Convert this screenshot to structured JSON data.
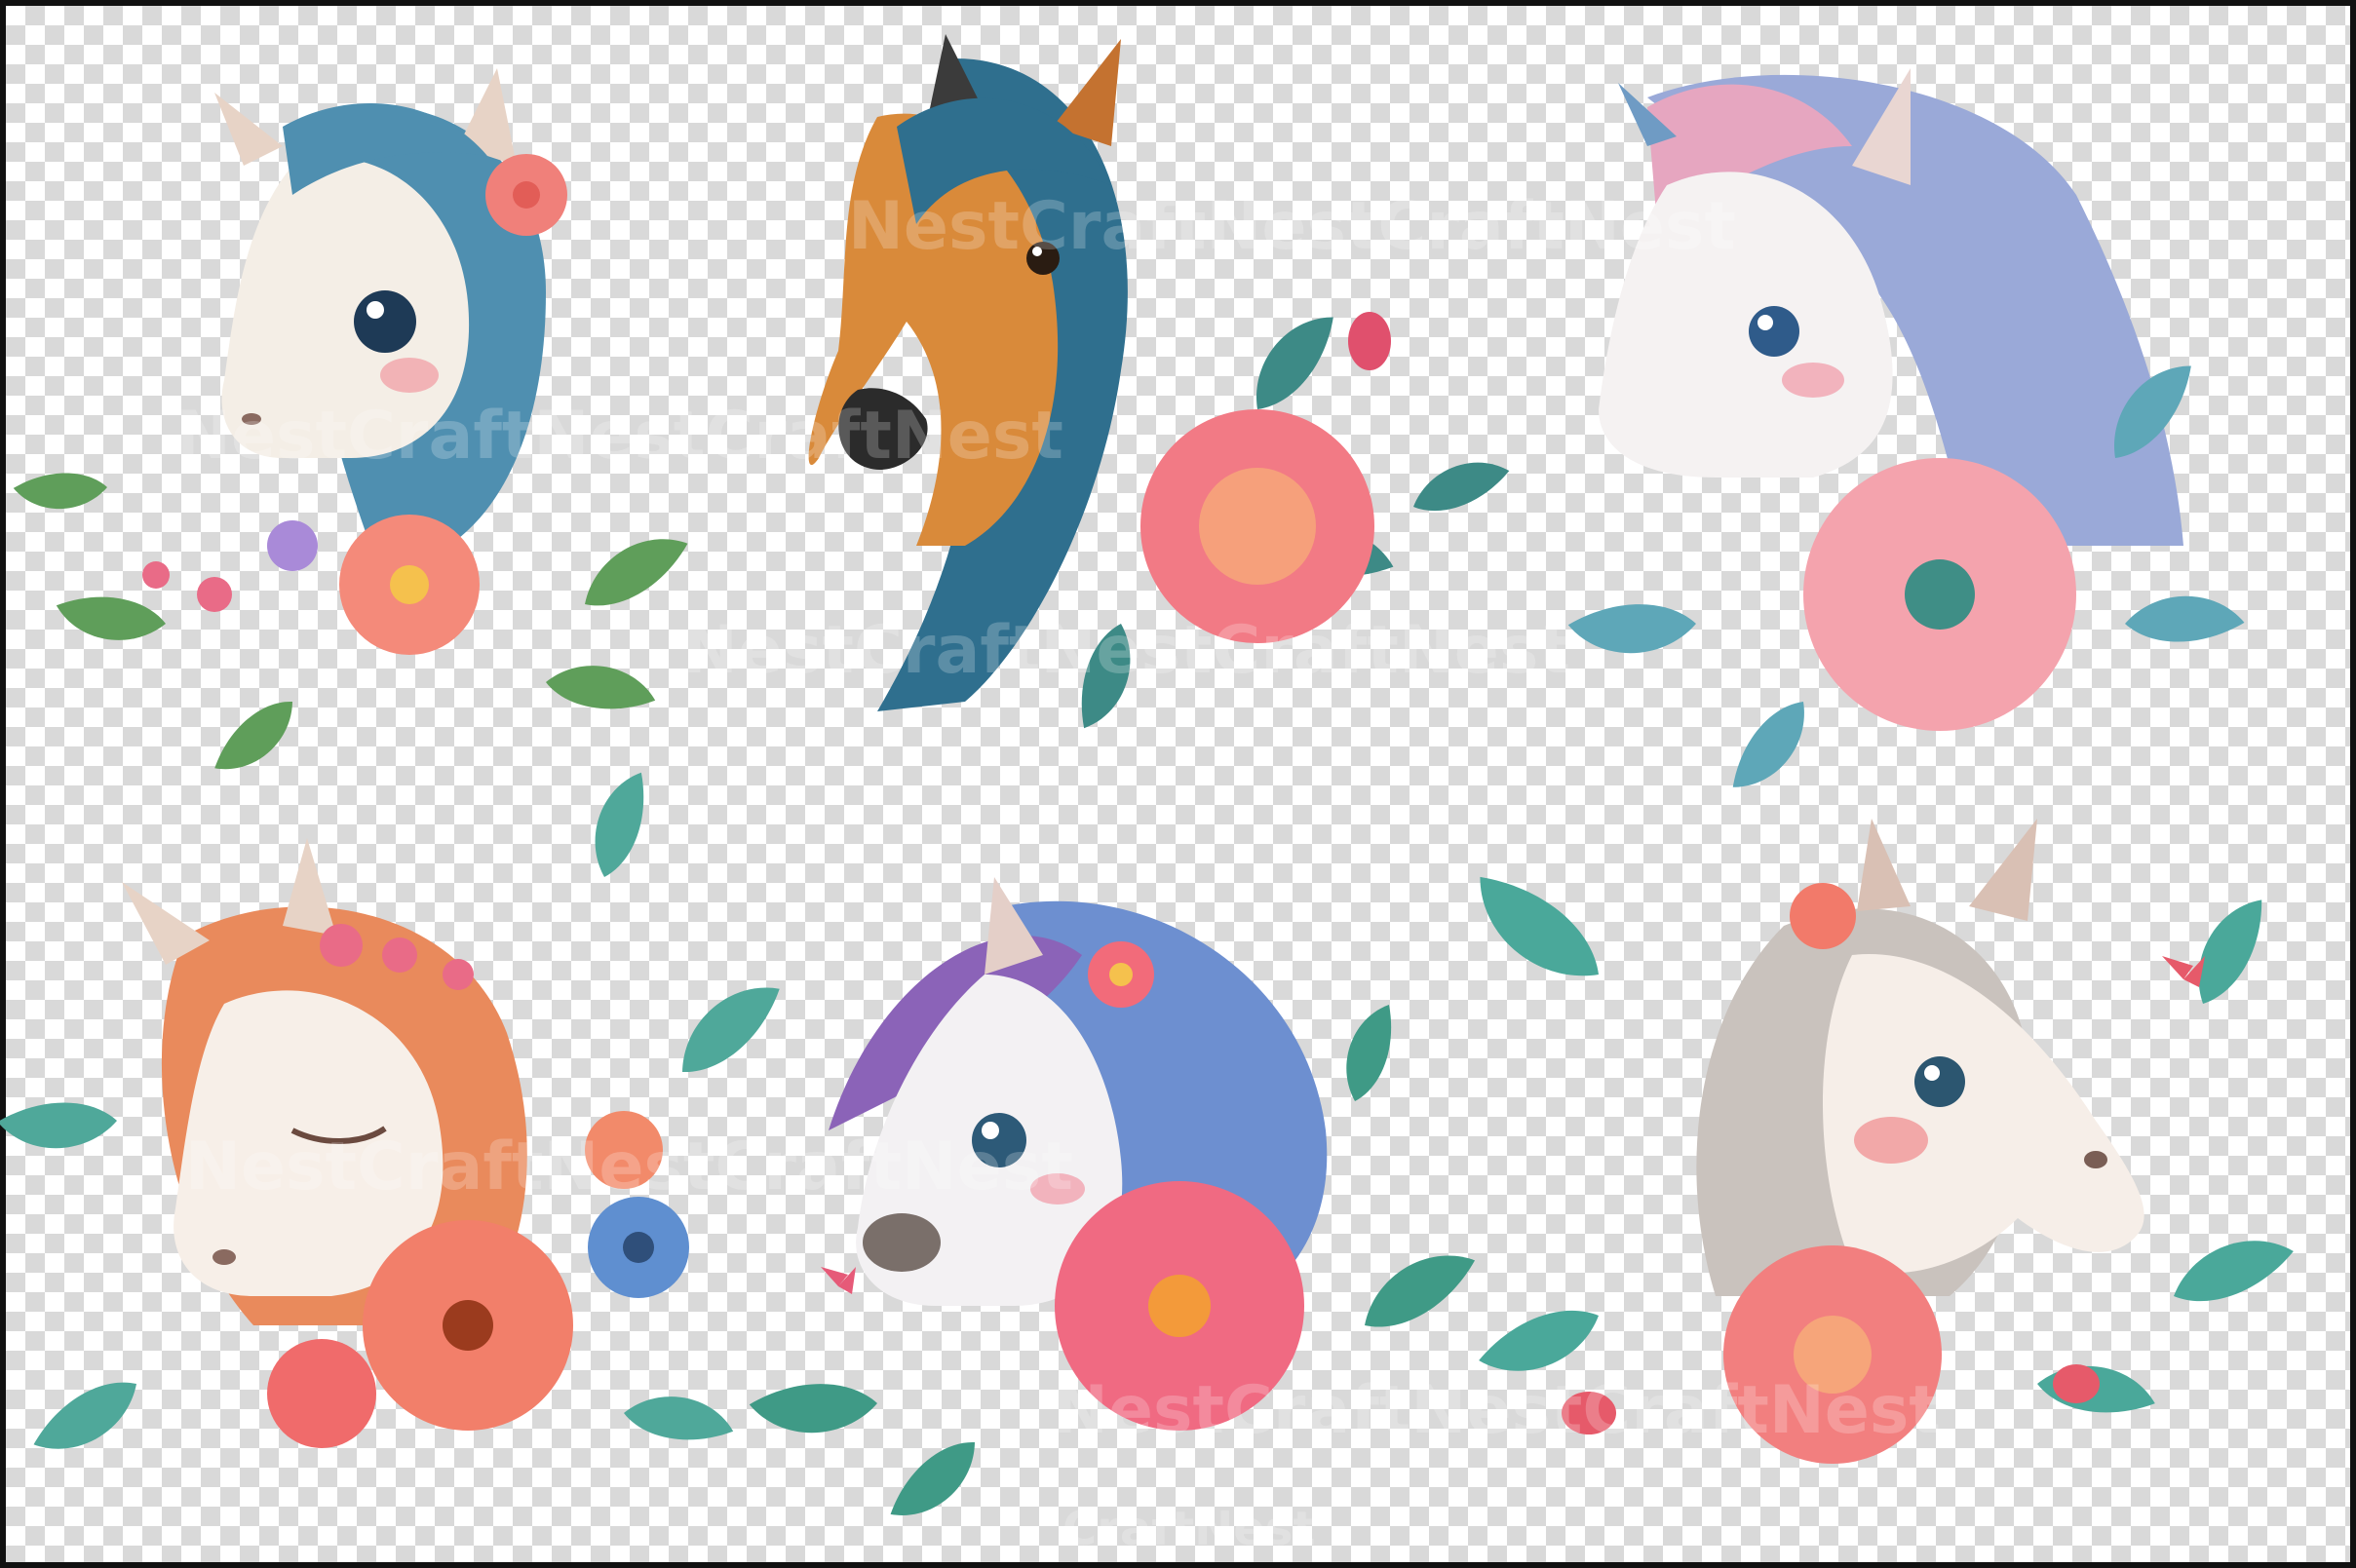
{
  "watermark": {
    "text": "NestCraftNestCraftNest",
    "footer": "CraftNest"
  },
  "illustrations": [
    {
      "subject": "pony",
      "mane": "#4f8fb0",
      "coat": "#f4eee6"
    },
    {
      "subject": "horse",
      "mane": "#2f6f8e",
      "coat": "#d98a3a"
    },
    {
      "subject": "unicorn",
      "mane": "#e6a6c0",
      "coat": "#f5f2f2"
    },
    {
      "subject": "pony",
      "mane": "#e98a5c",
      "coat": "#f7efe8"
    },
    {
      "subject": "pony",
      "mane": "#8b63b8",
      "coat": "#f3f1f3"
    },
    {
      "subject": "pony",
      "mane": "#c9c2bd",
      "coat": "#f6eee8"
    }
  ],
  "colors": {
    "checker_light": "#ffffff",
    "checker_dark": "#d9d9d9",
    "frame_border": "#111111"
  }
}
